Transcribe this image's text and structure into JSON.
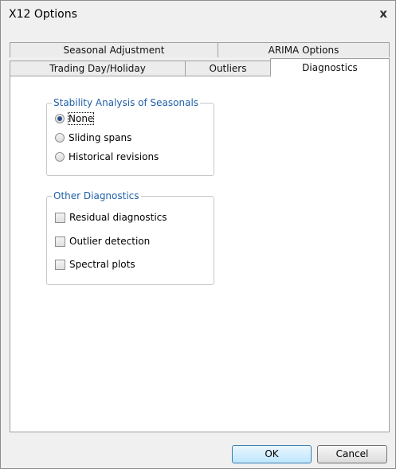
{
  "window": {
    "title": "X12 Options"
  },
  "tabs": {
    "row1": [
      "Seasonal Adjustment",
      "ARIMA Options"
    ],
    "row2": [
      "Trading Day/Holiday",
      "Outliers",
      "Diagnostics"
    ],
    "active": "Diagnostics"
  },
  "stability": {
    "legend": "Stability Analysis of Seasonals",
    "options": [
      "None",
      "Sliding spans",
      "Historical revisions"
    ],
    "selected": "None"
  },
  "other": {
    "legend": "Other Diagnostics",
    "options": [
      "Residual diagnostics",
      "Outlier detection",
      "Spectral plots"
    ],
    "checked": []
  },
  "buttons": {
    "ok": "OK",
    "cancel": "Cancel"
  }
}
